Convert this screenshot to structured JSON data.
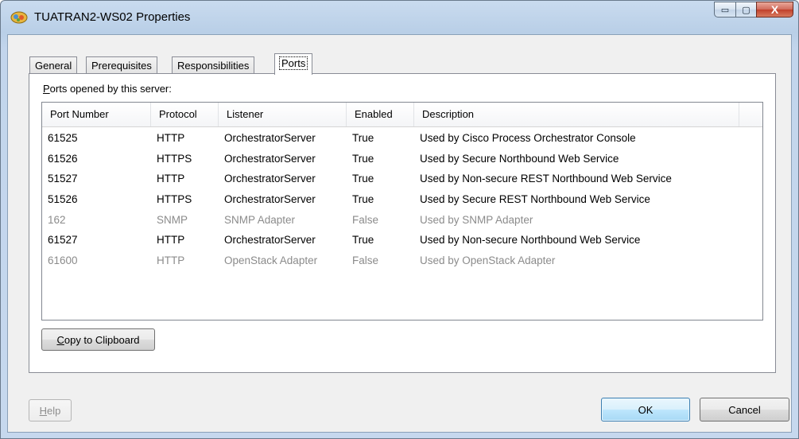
{
  "window": {
    "title": "TUATRAN2-WS02 Properties",
    "controls": {
      "minimize": "▭",
      "maximize": "▢",
      "close": "X"
    }
  },
  "tabs": [
    {
      "label": "General",
      "active": false
    },
    {
      "label": "Prerequisites",
      "active": false
    },
    {
      "label": "Responsibilities",
      "active": false
    },
    {
      "label": "Ports",
      "active": true
    }
  ],
  "ports": {
    "label_mnemonic": "P",
    "label_rest": "orts opened by this server:",
    "columns": [
      "Port Number",
      "Protocol",
      "Listener",
      "Enabled",
      "Description",
      ""
    ],
    "rows": [
      {
        "port": "61525",
        "protocol": "HTTP",
        "listener": "OrchestratorServer",
        "enabled": "True",
        "description": "Used by Cisco Process Orchestrator Console",
        "disabled": false
      },
      {
        "port": "61526",
        "protocol": "HTTPS",
        "listener": "OrchestratorServer",
        "enabled": "True",
        "description": "Used by Secure Northbound Web Service",
        "disabled": false
      },
      {
        "port": "51527",
        "protocol": "HTTP",
        "listener": "OrchestratorServer",
        "enabled": "True",
        "description": "Used by Non-secure REST Northbound Web Service",
        "disabled": false
      },
      {
        "port": "51526",
        "protocol": "HTTPS",
        "listener": "OrchestratorServer",
        "enabled": "True",
        "description": "Used by Secure REST Northbound Web Service",
        "disabled": false
      },
      {
        "port": "162",
        "protocol": "SNMP",
        "listener": "SNMP Adapter",
        "enabled": "False",
        "description": "Used by SNMP Adapter",
        "disabled": true
      },
      {
        "port": "61527",
        "protocol": "HTTP",
        "listener": "OrchestratorServer",
        "enabled": "True",
        "description": "Used by Non-secure Northbound Web Service",
        "disabled": false
      },
      {
        "port": "61600",
        "protocol": "HTTP",
        "listener": "OpenStack Adapter",
        "enabled": "False",
        "description": "Used by OpenStack Adapter",
        "disabled": true
      }
    ],
    "copy_button": {
      "mnemonic": "C",
      "rest": "opy to Clipboard"
    }
  },
  "footer": {
    "help": {
      "mnemonic": "H",
      "rest": "elp",
      "enabled": false
    },
    "ok": "OK",
    "cancel": "Cancel"
  }
}
